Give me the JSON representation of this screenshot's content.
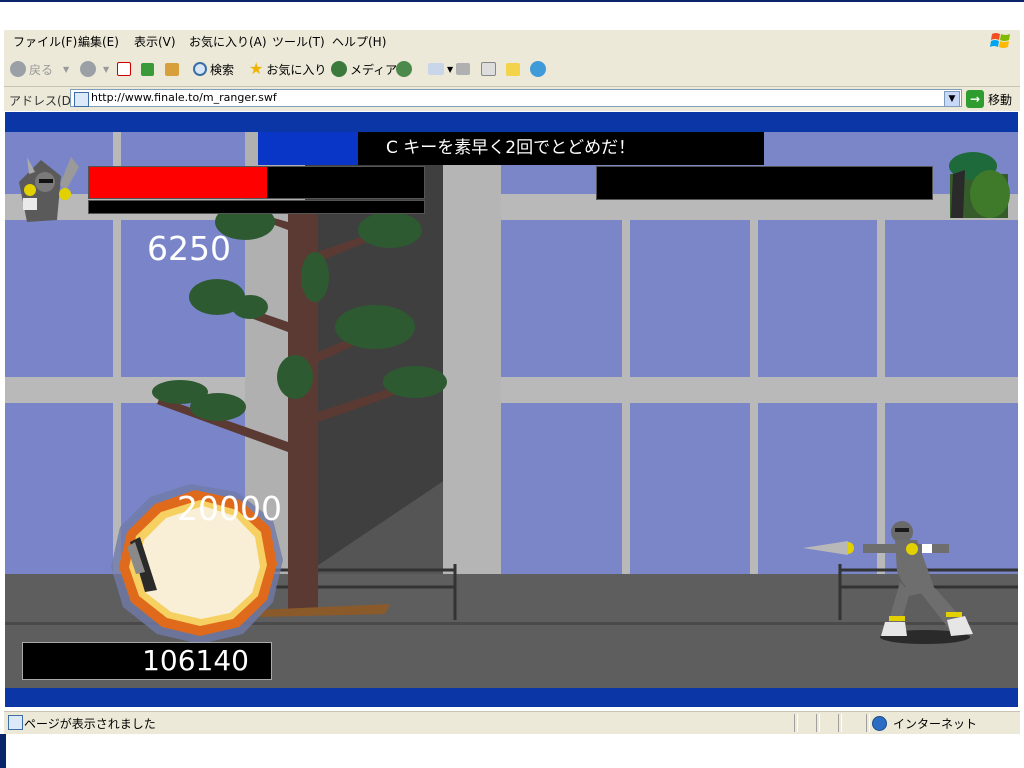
{
  "menu": {
    "items": [
      "ファイル(F)",
      "編集(E)",
      "表示(V)",
      "お気に入り(A)",
      "ツール(T)",
      "ヘルプ(H)"
    ]
  },
  "toolbar": {
    "back_label": "戻る",
    "search_label": "検索",
    "favorites_label": "お気に入り",
    "media_label": "メディア"
  },
  "address": {
    "label": "アドレス(D)",
    "url": "http://www.finale.to/m_ranger.swf",
    "go_label": "移動"
  },
  "game": {
    "instruction": "C キーを素早く2回でとどめだ！",
    "player_hp_fraction": 0.53,
    "enemy_hp_fraction": 0.0,
    "score": "106140",
    "float_score_1": "6250",
    "float_score_2": "20000"
  },
  "status": {
    "text": "ページが表示されました",
    "zone": "インターネット"
  },
  "colors": {
    "frame_blue": "#0a36a6",
    "hp_red": "#ff0000",
    "sky": "#7a85c9"
  }
}
